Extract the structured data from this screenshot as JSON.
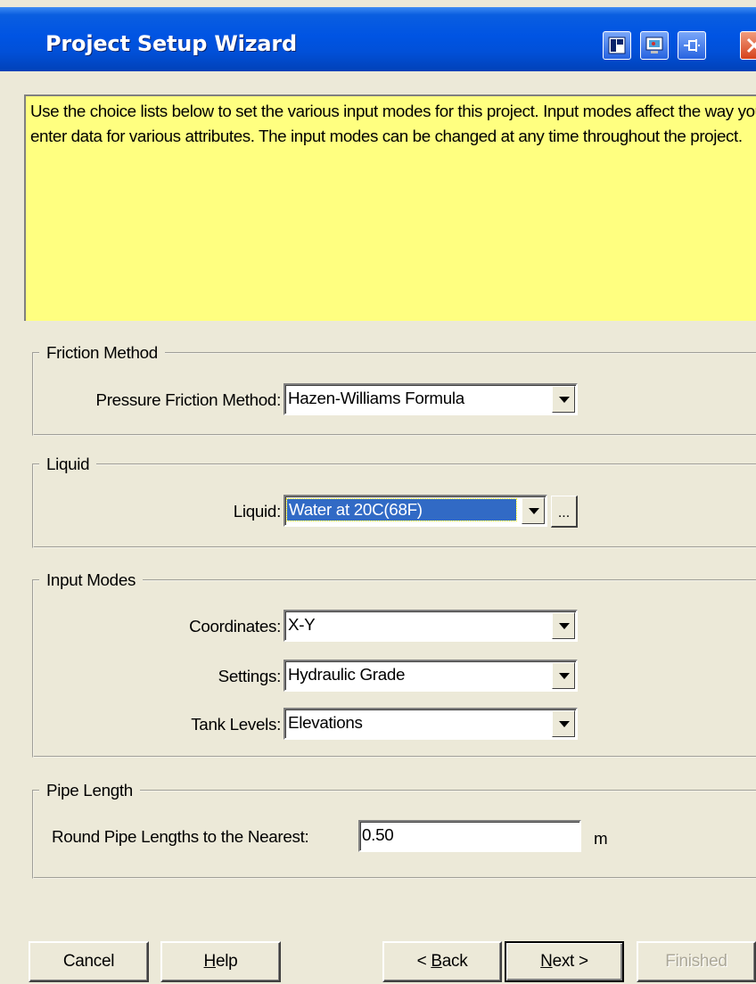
{
  "window": {
    "title": "Project Setup Wizard"
  },
  "help_panel": {
    "text": "Use the choice lists below to set the various input modes for this project. Input modes affect the way you enter data for various attributes. The input modes can be changed at any time throughout the project."
  },
  "friction": {
    "legend": "Friction Method",
    "label": "Pressure Friction Method:",
    "value": "Hazen-Williams Formula"
  },
  "liquid": {
    "legend": "Liquid",
    "label": "Liquid:",
    "value": "Water at 20C(68F)",
    "ellipsis": "..."
  },
  "input_modes": {
    "legend": "Input Modes",
    "coordinates_label": "Coordinates:",
    "coordinates_value": "X-Y",
    "settings_label": "Settings:",
    "settings_value": "Hydraulic Grade",
    "tank_label": "Tank Levels:",
    "tank_value": "Elevations"
  },
  "pipe_length": {
    "legend": "Pipe Length",
    "label": "Round Pipe Lengths to the Nearest:",
    "value": "0.50",
    "unit": "m"
  },
  "buttons": {
    "cancel": "Cancel",
    "help_key": "H",
    "help_rest": "elp",
    "back_pre": "< ",
    "back_key": "B",
    "back_rest": "ack",
    "next_key": "N",
    "next_rest": "ext >",
    "finished": "Finished"
  },
  "icons": {
    "titlebar": [
      "layout-icon",
      "monitor-icon",
      "pin-icon",
      "close-icon"
    ]
  },
  "colors": {
    "titlebar": "#0054e3",
    "help_background": "#ffff80",
    "selection": "#316ac5",
    "dialog_background": "#ece9d8",
    "close_button": "#d6411b"
  }
}
